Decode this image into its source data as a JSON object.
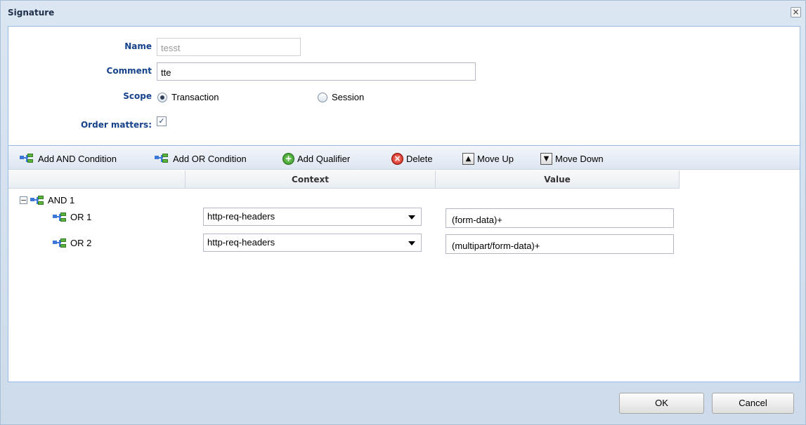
{
  "window": {
    "title": "Signature"
  },
  "form": {
    "name_label": "Name",
    "name_value": "tesst",
    "comment_label": "Comment",
    "comment_value": "tte",
    "scope_label": "Scope",
    "scope_options": [
      "Transaction",
      "Session"
    ],
    "scope_selected": "Transaction",
    "order_label": "Order matters:",
    "order_checked": true
  },
  "toolbar": {
    "add_and": "Add AND Condition",
    "add_or": "Add OR Condition",
    "add_qualifier": "Add Qualifier",
    "delete": "Delete",
    "move_up": "Move Up",
    "move_down": "Move Down"
  },
  "grid": {
    "columns": [
      "Context",
      "Value"
    ],
    "root": {
      "label": "AND 1"
    },
    "rows": [
      {
        "label": "OR 1",
        "context": "http-req-headers",
        "value": "(form-data)+"
      },
      {
        "label": "OR 2",
        "context": "http-req-headers",
        "value": "(multipart/form-data)+"
      }
    ]
  },
  "footer": {
    "ok": "OK",
    "cancel": "Cancel"
  },
  "colors": {
    "label_blue": "#15428b",
    "panel_border": "#99bbe8"
  }
}
